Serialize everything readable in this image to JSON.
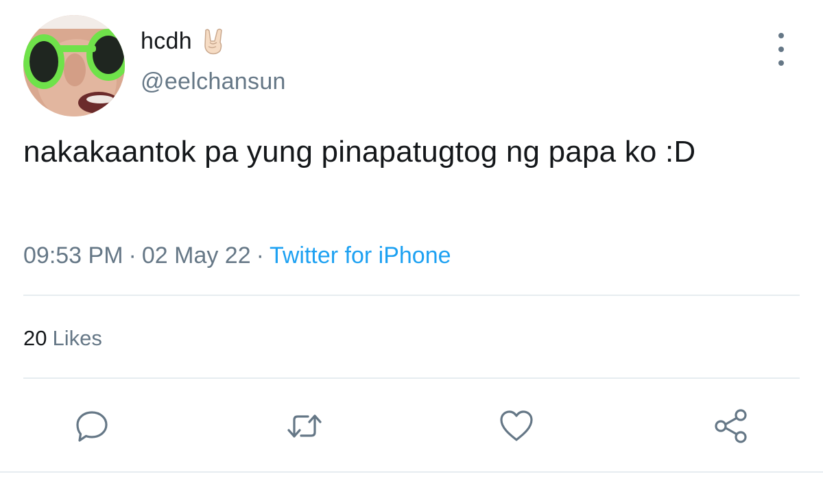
{
  "tweet": {
    "display_name": "hcdh",
    "name_emoji": "sign-of-the-horns-emoji",
    "handle": "@eelchansun",
    "text": "nakakaantok pa yung pinapatugtog ng papa ko :D",
    "time": "09:53 PM",
    "separator": "·",
    "date": "02 May 22",
    "source": "Twitter for iPhone",
    "likes_count": "20",
    "likes_label": "Likes"
  },
  "icons": {
    "more": "more-vertical-icon",
    "reply": "reply-icon",
    "retweet": "retweet-icon",
    "like": "heart-icon",
    "share": "share-icon"
  },
  "colors": {
    "text": "#14171a",
    "secondary": "#657786",
    "link": "#1da1f2",
    "divider": "#e6ecf0",
    "icon": "#657786"
  }
}
